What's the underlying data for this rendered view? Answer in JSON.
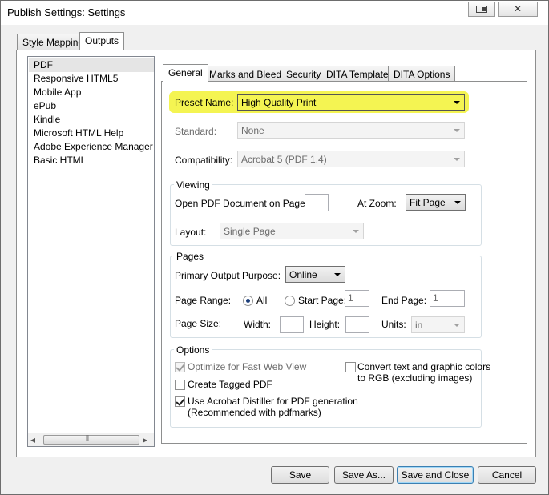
{
  "window": {
    "title": "Publish Settings: Settings",
    "restore_icon": "restore-window-icon",
    "close_symbol": "✕"
  },
  "top_tabs": [
    {
      "label": "Style Mapping",
      "selected": false
    },
    {
      "label": "Outputs",
      "selected": true
    }
  ],
  "outputs": [
    "PDF",
    "Responsive HTML5",
    "Mobile App",
    "ePub",
    "Kindle",
    "Microsoft HTML Help",
    "Adobe Experience Manager Mo",
    "Basic HTML"
  ],
  "scrollbar": {
    "left_arrow": "◂",
    "right_arrow": "▸",
    "grip": "⦀"
  },
  "inner_tabs": [
    {
      "label": "General",
      "selected": true
    },
    {
      "label": "Marks and Bleeds",
      "selected": false
    },
    {
      "label": "Security",
      "selected": false
    },
    {
      "label": "DITA Template",
      "selected": false
    },
    {
      "label": "DITA Options",
      "selected": false
    }
  ],
  "general": {
    "preset_label": "Preset Name:",
    "preset_value": "High Quality Print",
    "highlight_color": "#f4f452",
    "standard_label": "Standard:",
    "standard_value": "None",
    "compat_label": "Compatibility:",
    "compat_value": "Acrobat 5 (PDF 1.4)"
  },
  "viewing": {
    "title": "Viewing",
    "open_label": "Open PDF Document on Page:",
    "open_value": "",
    "zoom_label": "At Zoom:",
    "zoom_value": "Fit Page",
    "layout_label": "Layout:",
    "layout_value": "Single Page"
  },
  "pages": {
    "title": "Pages",
    "purpose_label": "Primary Output Purpose:",
    "purpose_value": "Online",
    "range_label": "Page Range:",
    "all_label": "All",
    "start_label": "Start Page:",
    "start_value": "1",
    "end_label": "End Page:",
    "end_value": "1",
    "size_label": "Page Size:",
    "width_label": "Width:",
    "width_value": "",
    "height_label": "Height:",
    "height_value": "",
    "units_label": "Units:",
    "units_value": "in"
  },
  "options": {
    "title": "Options",
    "fast_web": "Optimize for Fast Web View",
    "tagged": "Create Tagged PDF",
    "distiller_line1": "Use Acrobat Distiller for PDF generation",
    "distiller_line2": "(Recommended with pdfmarks)",
    "convert_line1": "Convert text and graphic colors",
    "convert_line2": "to RGB (excluding images)"
  },
  "buttons": {
    "save": "Save",
    "save_as": "Save As...",
    "save_close": "Save and Close",
    "cancel": "Cancel"
  }
}
